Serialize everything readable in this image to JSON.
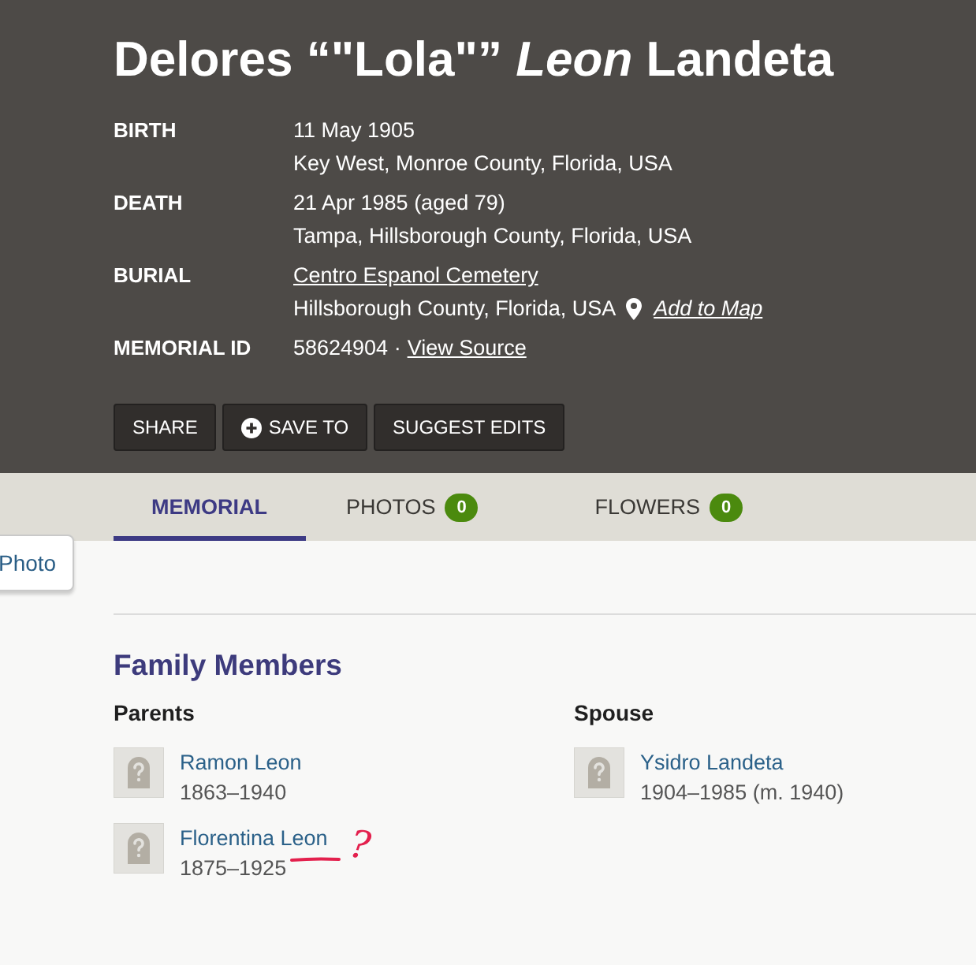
{
  "memorial": {
    "name": "Delores “\"Lola\"” *Leon* Landeta",
    "facts": [
      {
        "label": "BIRTH",
        "lines": [
          [
            {
              "kind": "text",
              "text": "11 May 1905"
            }
          ],
          [
            {
              "kind": "text",
              "text": "Key West, Monroe County, Florida, USA"
            }
          ]
        ]
      },
      {
        "label": "DEATH",
        "lines": [
          [
            {
              "kind": "text",
              "text": "21 Apr 1985 (aged 79)"
            }
          ],
          [
            {
              "kind": "text",
              "text": "Tampa, Hillsborough County, Florida, USA"
            }
          ]
        ]
      },
      {
        "label": "BURIAL",
        "lines": [
          [
            {
              "kind": "link",
              "text": "Centro Espanol Cemetery"
            }
          ],
          [
            {
              "kind": "text",
              "text": "Hillsborough County, Florida, USA"
            },
            {
              "kind": "map_link",
              "text": "Add to Map"
            }
          ]
        ]
      },
      {
        "label": "MEMORIAL ID",
        "lines": [
          [
            {
              "kind": "text",
              "text": "58624904 ·"
            },
            {
              "kind": "link",
              "text": "View Source"
            }
          ]
        ]
      }
    ],
    "actions": [
      {
        "label": "SHARE",
        "kind": "plain"
      },
      {
        "label": "SAVE TO",
        "kind": "save"
      },
      {
        "label": "SUGGEST EDITS",
        "kind": "plain"
      }
    ]
  },
  "tabs": [
    {
      "label": "MEMORIAL",
      "selected": true
    },
    {
      "label": "PHOTOS",
      "count": "0",
      "selected": false
    },
    {
      "label": "FLOWERS",
      "count": "0",
      "selected": false
    }
  ],
  "photo_button": {
    "label": "Photo"
  },
  "family": {
    "title": "Family Members",
    "groups": [
      {
        "title": "Parents",
        "members": [
          {
            "name": "Ramon Leon",
            "dates": "1863–1940"
          },
          {
            "name": "Florentina Leon",
            "dates": "1875–1925",
            "annotation": {
              "mark": "?"
            }
          }
        ]
      },
      {
        "title": "Spouse",
        "members": [
          {
            "name": "Ysidro Landeta",
            "dates": "1904–1985 (m. 1940)"
          }
        ]
      }
    ]
  }
}
